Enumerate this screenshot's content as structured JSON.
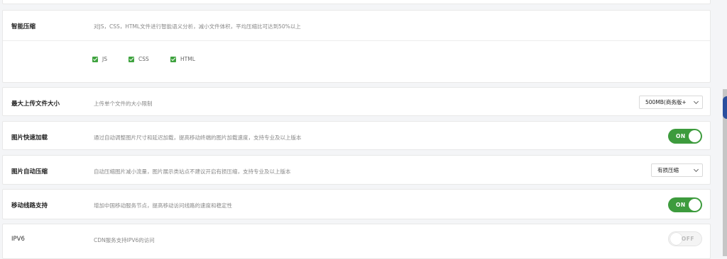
{
  "smart_compress": {
    "title": "智能压缩",
    "desc": "对JS，CSS，HTML文件进行智能语义分析，减小文件体积，平均压缩比可达到50%以上",
    "options": [
      {
        "label": "JS",
        "checked": true
      },
      {
        "label": "CSS",
        "checked": true
      },
      {
        "label": "HTML",
        "checked": true
      }
    ]
  },
  "upload_limit": {
    "title": "最大上传文件大小",
    "desc": "上传单个文件的大小限制",
    "selected": "500MB(商务版+"
  },
  "image_fast_load": {
    "title": "图片快速加载",
    "desc": "通过自动调整图片尺寸和延迟加载，提高移动终端的图片加载速度，支持专业及以上版本",
    "toggle_label": "ON",
    "enabled": true
  },
  "image_auto_compress": {
    "title": "图片自动压缩",
    "desc": "自动压缩图片减小流量，图片展示类站点不建议开启有损压缩，支持专业及以上版本",
    "selected": "有损压缩"
  },
  "mobile_line": {
    "title": "移动线路支持",
    "desc": "增加中国移动服务节点，提高移动访问线路的速度和稳定性",
    "toggle_label": "ON",
    "enabled": true
  },
  "ipv6": {
    "title": "IPV6",
    "desc": "CDN服务支持IPV6的访问",
    "toggle_label": "OFF",
    "enabled": false
  },
  "colors": {
    "accent_green": "#3d9b3d",
    "background": "#f4f5f7"
  }
}
